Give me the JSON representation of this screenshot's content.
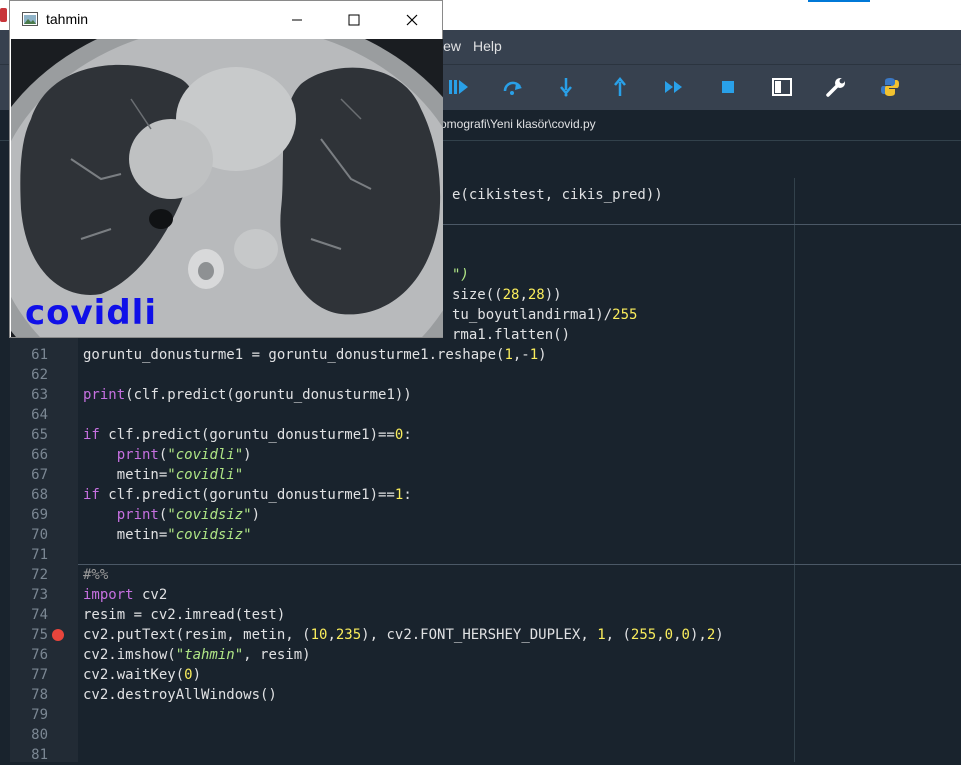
{
  "menubar": {
    "items": [
      "iew",
      "Help"
    ]
  },
  "toolbar": {
    "buttons": [
      "continue-icon",
      "step-over-icon",
      "step-into-icon",
      "step-return-icon",
      "fast-forward-icon",
      "stop-icon",
      "maximize-pane-icon",
      "preferences-icon",
      "python-path-icon"
    ]
  },
  "pathbar": {
    "path": "omografi\\Yeni klasör\\covid.py"
  },
  "cv_window": {
    "title": "tahmin",
    "overlay_text": "covidli",
    "overlay_color": "#1010e8"
  },
  "editor": {
    "line_numbers": [
      "61",
      "62",
      "63",
      "64",
      "65",
      "66",
      "67",
      "68",
      "69",
      "70",
      "71",
      "72",
      "73",
      "74",
      "75",
      "76",
      "77",
      "78",
      "79",
      "80",
      "81"
    ],
    "breakpoint_line": "75",
    "visible_fragments": {
      "f1": "e(cikistest, cikis_pred))",
      "f2": "\")",
      "f3": "size((28,28))",
      "f4": "tu_boyutlandirma1)/255",
      "f5": "rma1.flatten()"
    }
  },
  "colors": {
    "background": "#19232d",
    "menubar": "#37414f",
    "keyword": "#c670e0",
    "number": "#faed5c",
    "string": "#b0e686",
    "breakpoint": "#e8453c",
    "toolbar_icon": "#29a0e8"
  }
}
